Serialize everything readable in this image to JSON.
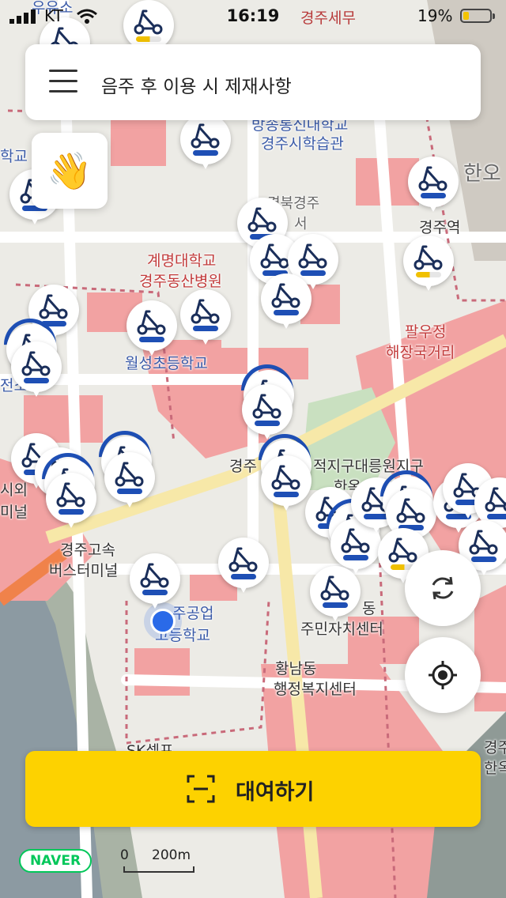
{
  "status_bar": {
    "carrier": "KT",
    "time": "16:19",
    "location_label": "경주세무",
    "battery": "19%"
  },
  "search_bar": {
    "title": "음주 후 이용 시 제재사항"
  },
  "map": {
    "labels": {
      "l1": "방송통신대학교",
      "l2": "경주시학습관",
      "l3": "경북경주",
      "l4": "서",
      "l5": "경주역",
      "l6": "계명대학교",
      "l7": "경주동산병원",
      "l8": "팔우정",
      "l9": "해장국거리",
      "l10": "월성초등학교",
      "l11": "경주",
      "l12": "적지구대릉원지구",
      "l13": "한옥",
      "l14": "시외",
      "l15": "미널",
      "l16": "경주고속",
      "l17": "버스터미널",
      "l18": "주공업",
      "l19": "고등학교",
      "l20": "동",
      "l21": "주민자치센터",
      "l22": "황남동",
      "l23": "행정복지센터",
      "l24": "SK셀프",
      "l25": "경주",
      "l26": "한옥",
      "l27": "학교",
      "l28": "전소",
      "l29": "우유소",
      "l30": "한오"
    }
  },
  "buttons": {
    "rent_label": "대여하기",
    "wave_icon": "waving-hand-icon",
    "refresh_icon": "refresh-icon",
    "locate_icon": "crosshair-icon"
  },
  "map_footer": {
    "logo": "NAVER",
    "scale_zero": "0",
    "scale_distance": "200m"
  },
  "colors": {
    "accent": "#fdd200",
    "pin_blue": "#1e4fb5",
    "zone_red": "#f2a6a6"
  }
}
